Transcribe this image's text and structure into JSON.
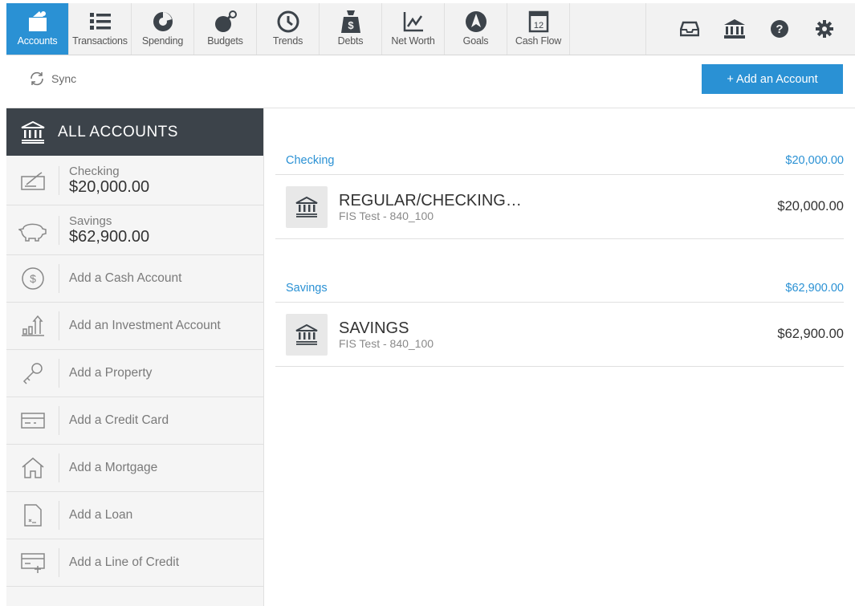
{
  "nav": {
    "items": [
      {
        "label": "Accounts",
        "icon": "accounts-icon"
      },
      {
        "label": "Transactions",
        "icon": "list-icon"
      },
      {
        "label": "Spending",
        "icon": "pie-icon"
      },
      {
        "label": "Budgets",
        "icon": "bomb-icon"
      },
      {
        "label": "Trends",
        "icon": "clock-icon"
      },
      {
        "label": "Debts",
        "icon": "money-bag-icon"
      },
      {
        "label": "Net Worth",
        "icon": "line-chart-icon"
      },
      {
        "label": "Goals",
        "icon": "compass-icon"
      },
      {
        "label": "Cash Flow",
        "icon": "calendar-icon",
        "day": "12"
      }
    ],
    "active_color": "#2a91d4"
  },
  "toolbar": {
    "sync_label": "Sync",
    "add_account_label": "+ Add an Account"
  },
  "sidebar": {
    "header_label": "ALL ACCOUNTS",
    "accounts": [
      {
        "name": "Checking",
        "amount": "$20,000.00",
        "icon": "check-icon"
      },
      {
        "name": "Savings",
        "amount": "$62,900.00",
        "icon": "piggy-bank-icon"
      }
    ],
    "add_items": [
      {
        "label": "Add a Cash Account",
        "icon": "dollar-icon"
      },
      {
        "label": "Add an Investment Account",
        "icon": "investment-icon"
      },
      {
        "label": "Add a Property",
        "icon": "key-icon"
      },
      {
        "label": "Add a Credit Card",
        "icon": "credit-card-icon"
      },
      {
        "label": "Add a Mortgage",
        "icon": "house-icon"
      },
      {
        "label": "Add a Loan",
        "icon": "document-icon"
      },
      {
        "label": "Add a Line of Credit",
        "icon": "line-of-credit-icon"
      }
    ]
  },
  "main": {
    "groups": [
      {
        "title": "Checking",
        "total": "$20,000.00",
        "accounts": [
          {
            "name": "REGULAR/CHECKING…",
            "subtitle": "FIS Test - 840_100",
            "balance": "$20,000.00"
          }
        ]
      },
      {
        "title": "Savings",
        "total": "$62,900.00",
        "accounts": [
          {
            "name": "SAVINGS",
            "subtitle": "FIS Test - 840_100",
            "balance": "$62,900.00"
          }
        ]
      }
    ]
  }
}
